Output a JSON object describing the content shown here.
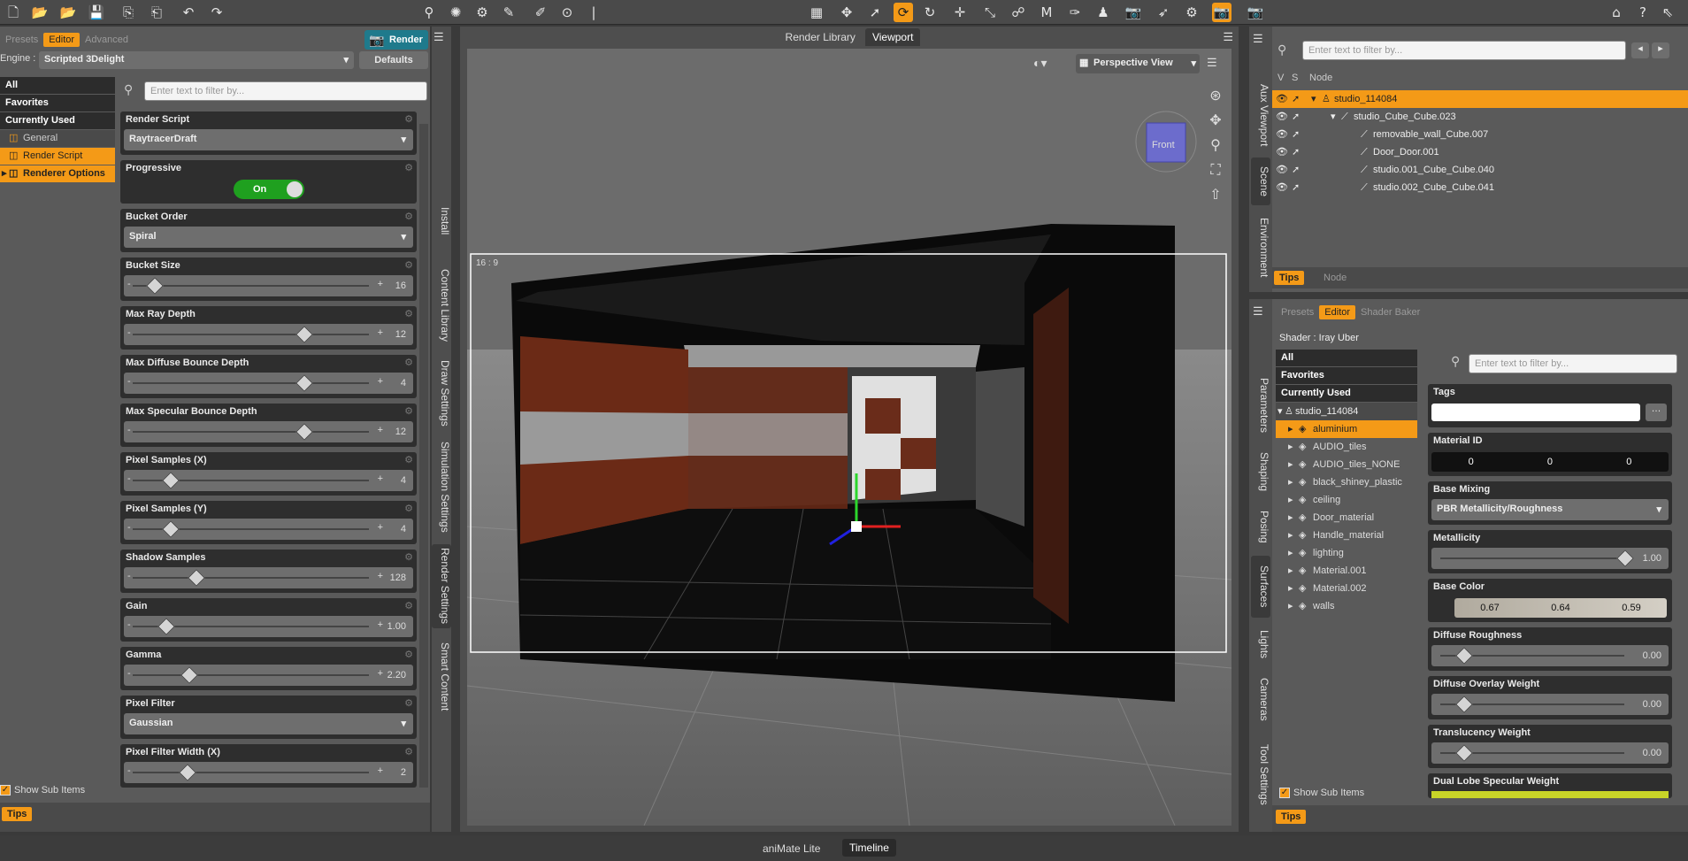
{
  "toolbar": {
    "icons": [
      "new-file",
      "open-file",
      "merge-file",
      "save-file",
      "import",
      "export",
      "undo",
      "redo"
    ]
  },
  "left_panel": {
    "tabs": [
      "Presets",
      "Editor",
      "Advanced"
    ],
    "render_button": "Render",
    "engine_label": "Engine :",
    "engine_value": "Scripted 3Delight",
    "defaults_button": "Defaults",
    "filter_placeholder": "Enter text to filter by...",
    "categories": [
      "All",
      "Favorites",
      "Currently Used",
      "General",
      "Render Script",
      "Renderer Options"
    ],
    "properties": [
      {
        "title": "Render Script",
        "kind": "dropdown",
        "value": "RaytracerDraft"
      },
      {
        "title": "Progressive",
        "kind": "toggle",
        "value": "On"
      },
      {
        "title": "Bucket Order",
        "kind": "dropdown",
        "value": "Spiral"
      },
      {
        "title": "Bucket Size",
        "kind": "slider",
        "value": "16",
        "pos": 0.07
      },
      {
        "title": "Max Ray Depth",
        "kind": "slider",
        "value": "12",
        "pos": 0.72
      },
      {
        "title": "Max Diffuse Bounce Depth",
        "kind": "slider",
        "value": "4",
        "pos": 0.72
      },
      {
        "title": "Max Specular Bounce Depth",
        "kind": "slider",
        "value": "12",
        "pos": 0.72
      },
      {
        "title": "Pixel Samples (X)",
        "kind": "slider",
        "value": "4",
        "pos": 0.14
      },
      {
        "title": "Pixel Samples (Y)",
        "kind": "slider",
        "value": "4",
        "pos": 0.14
      },
      {
        "title": "Shadow Samples",
        "kind": "slider",
        "value": "128",
        "pos": 0.25
      },
      {
        "title": "Gain",
        "kind": "slider",
        "value": "1.00",
        "pos": 0.12
      },
      {
        "title": "Gamma",
        "kind": "slider",
        "value": "2.20",
        "pos": 0.22
      },
      {
        "title": "Pixel Filter",
        "kind": "dropdown",
        "value": "Gaussian"
      },
      {
        "title": "Pixel Filter Width (X)",
        "kind": "slider",
        "value": "2",
        "pos": 0.21
      }
    ],
    "side_tabs": [
      "Install",
      "Content Library",
      "Draw Settings",
      "Simulation Settings",
      "Render Settings",
      "Smart Content"
    ],
    "show_sub_items": "Show Sub Items",
    "tips": "Tips"
  },
  "viewport": {
    "tabs": [
      "Render Library",
      "Viewport"
    ],
    "view_name": "Perspective View",
    "aspect": "16 : 9",
    "cube_label": "Front"
  },
  "scene": {
    "side_tabs": [
      "Aux Viewport",
      "Scene",
      "Environment"
    ],
    "filter_placeholder": "Enter text to filter by...",
    "cols": [
      "V",
      "S",
      "Node"
    ],
    "nodes": [
      {
        "name": "studio_114084",
        "indent": 0,
        "selected": true
      },
      {
        "name": "studio_Cube_Cube.023",
        "indent": 1
      },
      {
        "name": "removable_wall_Cube.007",
        "indent": 2
      },
      {
        "name": "Door_Door.001",
        "indent": 2
      },
      {
        "name": "studio.001_Cube_Cube.040",
        "indent": 2
      },
      {
        "name": "studio.002_Cube_Cube.041",
        "indent": 2
      }
    ],
    "bottom_tabs": [
      "Tips",
      "Node"
    ]
  },
  "surfaces": {
    "side_tabs": [
      "Parameters",
      "Shaping",
      "Posing",
      "Surfaces",
      "Lights",
      "Cameras",
      "Tool Settings"
    ],
    "tabs": [
      "Presets",
      "Editor",
      "Shader Baker"
    ],
    "shader": "Shader : Iray Uber",
    "categories": [
      "All",
      "Favorites",
      "Currently Used"
    ],
    "root": "studio_114084",
    "materials": [
      "aluminium",
      "AUDIO_tiles",
      "AUDIO_tiles_NONE",
      "black_shiney_plastic",
      "ceiling",
      "Door_material",
      "Handle_material",
      "lighting",
      "Material.001",
      "Material.002",
      "walls"
    ],
    "filter_placeholder": "Enter text to filter by...",
    "props": {
      "tags": "Tags",
      "material_id": "Material ID",
      "material_id_values": [
        "0",
        "0",
        "0"
      ],
      "base_mixing": "Base Mixing",
      "base_mixing_value": "PBR Metallicity/Roughness",
      "metallicity": "Metallicity",
      "metallicity_value": "1.00",
      "base_color": "Base Color",
      "base_color_values": [
        "0.67",
        "0.64",
        "0.59"
      ],
      "diffuse_roughness": "Diffuse Roughness",
      "diffuse_roughness_value": "0.00",
      "diffuse_overlay_weight": "Diffuse Overlay Weight",
      "diffuse_overlay_weight_value": "0.00",
      "translucency_weight": "Translucency Weight",
      "translucency_weight_value": "0.00",
      "dual_lobe": "Dual Lobe Specular Weight"
    },
    "show_sub_items": "Show Sub Items",
    "tips": "Tips"
  },
  "bottom": {
    "tabs": [
      "aniMate Lite",
      "Timeline"
    ]
  },
  "colors": {
    "accent": "#f49a17",
    "toggle_on": "#1fa01f"
  }
}
